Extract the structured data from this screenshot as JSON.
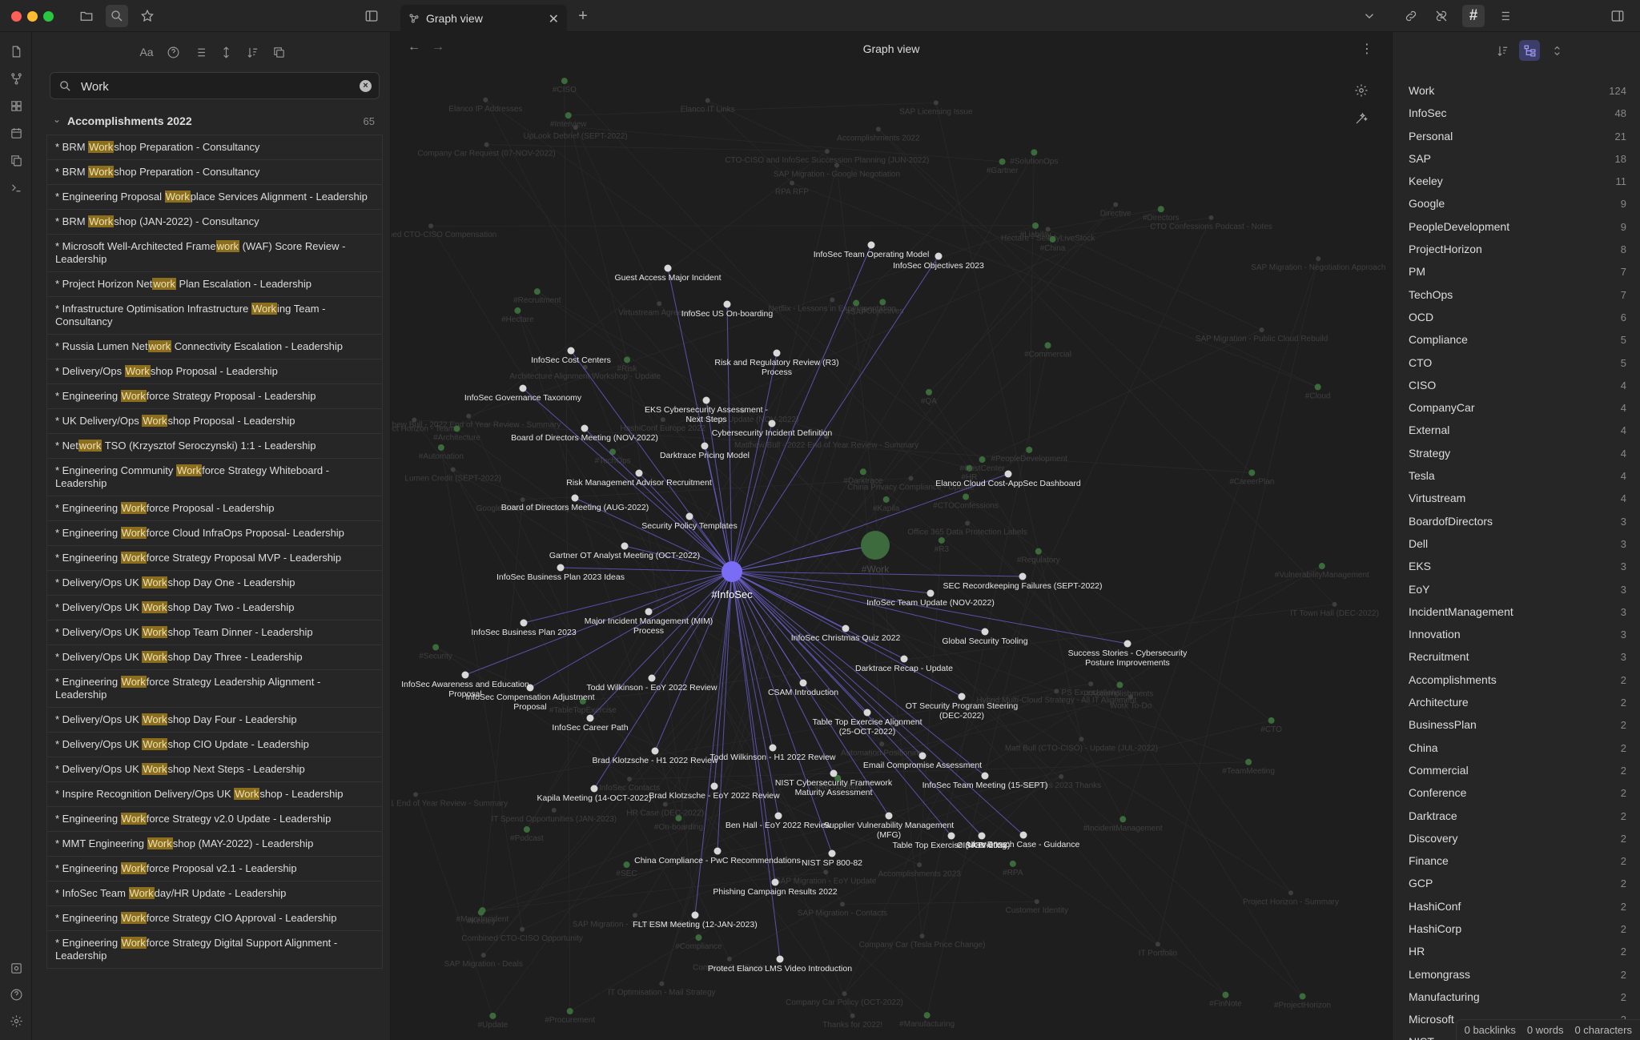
{
  "window": {
    "tab_title": "Graph view"
  },
  "search": {
    "query": "Work",
    "group_title": "Accomplishments 2022",
    "group_count": "65",
    "results": [
      [
        "* BRM ",
        "Work",
        "shop Preparation - Consultancy"
      ],
      [
        "* BRM ",
        "Work",
        "shop Preparation - Consultancy"
      ],
      [
        "* Engineering Proposal ",
        "Work",
        "place Services Alignment - Leadership"
      ],
      [
        "* BRM ",
        "Work",
        "shop (JAN-2022) - Consultancy"
      ],
      [
        "* Microsoft Well-Architected Frame",
        "work",
        " (WAF) Score Review - Leadership"
      ],
      [
        "* Project Horizon Net",
        "work",
        " Plan Escalation - Leadership"
      ],
      [
        "* Infrastructure Optimisation Infrastructure ",
        "Work",
        "ing Team - Consultancy"
      ],
      [
        "* Russia Lumen Net",
        "work",
        " Connectivity Escalation - Leadership"
      ],
      [
        "* Delivery/Ops ",
        "Work",
        "shop Proposal - Leadership"
      ],
      [
        "* Engineering ",
        "Work",
        "force Strategy Proposal - Leadership"
      ],
      [
        "* UK Delivery/Ops ",
        "Work",
        "shop Proposal - Leadership"
      ],
      [
        "* Net",
        "work",
        " TSO (Krzysztof Seroczynski) 1:1 - Leadership"
      ],
      [
        "* Engineering Community ",
        "Work",
        "force Strategy Whiteboard - Leadership"
      ],
      [
        "* Engineering ",
        "Work",
        "force Proposal - Leadership"
      ],
      [
        "* Engineering ",
        "Work",
        "force Cloud InfraOps Proposal- Leadership"
      ],
      [
        "* Engineering ",
        "Work",
        "force Strategy Proposal MVP - Leadership"
      ],
      [
        "* Delivery/Ops UK ",
        "Work",
        "shop Day One - Leadership"
      ],
      [
        "* Delivery/Ops UK ",
        "Work",
        "shop Day Two - Leadership"
      ],
      [
        "* Delivery/Ops UK ",
        "Work",
        "shop Team Dinner - Leadership"
      ],
      [
        "* Delivery/Ops UK ",
        "Work",
        "shop Day Three - Leadership"
      ],
      [
        "* Engineering ",
        "Work",
        "force Strategy Leadership Alignment - Leadership"
      ],
      [
        "* Delivery/Ops UK ",
        "Work",
        "shop Day Four - Leadership"
      ],
      [
        "* Delivery/Ops UK ",
        "Work",
        "shop CIO Update - Leadership"
      ],
      [
        "* Delivery/Ops UK ",
        "Work",
        "shop Next Steps - Leadership"
      ],
      [
        "* Inspire Recognition Delivery/Ops UK ",
        "Work",
        "shop - Leadership"
      ],
      [
        "* Engineering ",
        "Work",
        "force Strategy v2.0 Update - Leadership"
      ],
      [
        "* MMT Engineering ",
        "Work",
        "shop (MAY-2022) - Leadership"
      ],
      [
        "* Engineering ",
        "Work",
        "force Proposal v2.1 - Leadership"
      ],
      [
        "* InfoSec Team ",
        "Work",
        "day/HR Update - Leadership"
      ],
      [
        "* Engineering ",
        "Work",
        "force Strategy CIO Approval - Leadership"
      ],
      [
        "* Engineering ",
        "Work",
        "force Strategy Digital Support Alignment - Leadership"
      ]
    ]
  },
  "graph": {
    "title": "Graph view",
    "hub_label": "#InfoSec",
    "work_label": "#Work",
    "colors": {
      "hub": "#7b6cf6",
      "work": "#3d6b3d",
      "node": "#d8d8d8",
      "edge": "#6f63d6",
      "bg_node": "#3b6b3b"
    },
    "nodes": [
      {
        "label": "Guest Access Major Incident"
      },
      {
        "label": "InfoSec Team Operating Model"
      },
      {
        "label": "InfoSec Objectives 2023"
      },
      {
        "label": "InfoSec US On-boarding"
      },
      {
        "label": "InfoSec Cost Centers"
      },
      {
        "label": "Risk and Regulatory Review (R3) Process"
      },
      {
        "label": "EKS Cybersecurity Assessment - Next Steps"
      },
      {
        "label": "InfoSec Governance Taxonomy"
      },
      {
        "label": "Board of Directors Meeting (NOV-2022)"
      },
      {
        "label": "Cybersecurity Incident Definition"
      },
      {
        "label": "Darktrace Pricing Model"
      },
      {
        "label": "Risk Management Advisor Recruitment"
      },
      {
        "label": "Board of Directors Meeting (AUG-2022)"
      },
      {
        "label": "Security Policy Templates"
      },
      {
        "label": "Elanco Cloud Cost-AppSec Dashboard"
      },
      {
        "label": "Gartner OT Analyst Meeting (OCT-2022)"
      },
      {
        "label": "InfoSec Business Plan 2023 Ideas"
      },
      {
        "label": "SEC Recordkeeping Failures (SEPT-2022)"
      },
      {
        "label": "InfoSec Team Update (NOV-2022)"
      },
      {
        "label": "Major Incident Management (MIM) Process"
      },
      {
        "label": "InfoSec Business Plan 2023"
      },
      {
        "label": "InfoSec Christmas Quiz 2022"
      },
      {
        "label": "Global Security Tooling"
      },
      {
        "label": "Success Stories - Cybersecurity Posture Improvements"
      },
      {
        "label": "Darktrace Recap - Update"
      },
      {
        "label": "InfoSec Awareness and Education Proposal"
      },
      {
        "label": "Todd Wilkinson - EoY 2022 Review"
      },
      {
        "label": "InfoSec Compensation Adjustment Proposal"
      },
      {
        "label": "CSAM Introduction"
      },
      {
        "label": "OT Security Program Steering (DEC-2022)"
      },
      {
        "label": "InfoSec Career Path"
      },
      {
        "label": "Table Top Exercise Alignment (25-OCT-2022)"
      },
      {
        "label": "Brad Klotzsche - H1 2022 Review"
      },
      {
        "label": "Todd Wilkinson - H1 2022 Review"
      },
      {
        "label": "Email Compromise Assessment"
      },
      {
        "label": "Kapila Meeting (14-OCT-2022)"
      },
      {
        "label": "Brad Klotzsche - EoY 2022 Review"
      },
      {
        "label": "NIST Cybersecurity Framework Maturity Assessment"
      },
      {
        "label": "InfoSec Team Meeting (15-SEPT)"
      },
      {
        "label": "Ben Hall - EoY 2022 Review"
      },
      {
        "label": "Supplier Vulnerability Management (MFG)"
      },
      {
        "label": "Table Top Exercise (NOV-2022)"
      },
      {
        "label": "CISA Briefing"
      },
      {
        "label": "Uber Breach Case - Guidance"
      },
      {
        "label": "China Compliance - PwC Recommendations"
      },
      {
        "label": "NIST SP 800-82"
      },
      {
        "label": "Phishing Campaign Results 2022"
      },
      {
        "label": "FLT ESM Meeting (12-JAN-2023)"
      },
      {
        "label": "Protect Elanco LMS Video Introduction"
      }
    ],
    "bg_labels": [
      "#Hectare",
      "#MajorIncident",
      "#HR",
      "#On-boarding",
      "#SolutionOps",
      "#Objectives",
      "Hectare - SellMyLiveStock",
      "#R3",
      "UpLook Debrief (SEPT-2022)",
      "#ProjectHorizon",
      "Google EBC (SEPT-2022)",
      "SAP Migration - Negotiation Approach",
      "#Commercial",
      "#Procurement",
      "Netflix - Lessons in Experimentation",
      "#QA",
      "IT Spend Opportunities (JAN-2023)",
      "IT Strategy Update (NOV-2022)",
      "SAP Migration - Deals",
      "SAP Migration - Timeline and Team",
      "#SAP",
      "#CostCenter",
      "Work To-Do",
      "#Recruitment",
      "SAP Migration - Google Negotiation",
      "Lumen Credit (SEPT-2022)",
      "Hybrid Multi-Cloud Strategy - All IT Alignment",
      "#Cloud",
      "SAP Migration - EoY Update",
      "Virtustream Agreement",
      "Directive",
      "HR Case (DEC-2022)",
      "#FinNote",
      "Project Horizon - Summary",
      "#Accomplishments",
      "SAP Licensing Issue",
      "#TechOps",
      "TechOps 2023 Thanks",
      "IT Optimisation - Mail Strategy",
      "Project Horizon - Team",
      "#CTOConfessions",
      "#Update",
      "SAP Migration - Contacts",
      "Office 365 Data Protection Labels",
      "#Podcast",
      "SAP Migration - Public Cloud Rebuild",
      "Combined CTO-CISO Compensation",
      "Matt Bull (CTO-CISO) - Update (JUL-2022)",
      "Customer Identity",
      "#SEC",
      "#Interview",
      "Elanco IP Addresses",
      "Accomplishments 2023",
      "CTO Confessions Podcast - Notes",
      "Accomplishments 2022",
      "Matthew Bull - 2022 End of Year Review - Summary",
      "#Risk",
      "#Directors",
      "#CISO",
      "#Gartner",
      "RPA RFP",
      "#Darktrace",
      "Matthew Bull - 2021 End of Year Review - Summary",
      "#Recognition",
      "Company Car Quote",
      "PS Expectations",
      "HashiConf Europe 2022",
      "#Keeley",
      "Company Car Request (07-NOV-2022)",
      "Architecture Alignment Workshop - Update",
      "#Security",
      "Matthew Bull - 2022 End of Year Review - Summary",
      "Company Car (Tesla Price Change)",
      "China Privacy Compliance - Update",
      "Combined CTO-CISO Opportunity",
      "#Regulatory",
      "#CTO",
      "Company Car Policy (OCT-2022)",
      "#CareerPlan",
      "Automation Positioning",
      "IT Portfolio",
      "#Manufacturing",
      "#RPA",
      "CTO-CISO and InfoSec Succession Planning (JUN-2022)",
      "IT Town Hall (DEC-2022)",
      "#PeopleDevelopment",
      "#IncidentManagement",
      "#Kapila",
      "#TeamMeeting",
      "#Architecture",
      "Thanks for 2022!",
      "#Liability",
      "#China",
      "Elanco IT Links",
      "#VulnerabilityManagement",
      "#Automation",
      "#TableTopExercise",
      "InfoSec Contacts",
      "#Compliance"
    ]
  },
  "tags": [
    {
      "name": "Work",
      "count": "124"
    },
    {
      "name": "InfoSec",
      "count": "48"
    },
    {
      "name": "Personal",
      "count": "21"
    },
    {
      "name": "SAP",
      "count": "18"
    },
    {
      "name": "Keeley",
      "count": "11"
    },
    {
      "name": "Google",
      "count": "9"
    },
    {
      "name": "PeopleDevelopment",
      "count": "9"
    },
    {
      "name": "ProjectHorizon",
      "count": "8"
    },
    {
      "name": "PM",
      "count": "7"
    },
    {
      "name": "TechOps",
      "count": "7"
    },
    {
      "name": "OCD",
      "count": "6"
    },
    {
      "name": "Compliance",
      "count": "5"
    },
    {
      "name": "CTO",
      "count": "5"
    },
    {
      "name": "CISO",
      "count": "4"
    },
    {
      "name": "CompanyCar",
      "count": "4"
    },
    {
      "name": "External",
      "count": "4"
    },
    {
      "name": "Strategy",
      "count": "4"
    },
    {
      "name": "Tesla",
      "count": "4"
    },
    {
      "name": "Virtustream",
      "count": "4"
    },
    {
      "name": "BoardofDirectors",
      "count": "3"
    },
    {
      "name": "Dell",
      "count": "3"
    },
    {
      "name": "EKS",
      "count": "3"
    },
    {
      "name": "EoY",
      "count": "3"
    },
    {
      "name": "IncidentManagement",
      "count": "3"
    },
    {
      "name": "Innovation",
      "count": "3"
    },
    {
      "name": "Recruitment",
      "count": "3"
    },
    {
      "name": "Accomplishments",
      "count": "2"
    },
    {
      "name": "Architecture",
      "count": "2"
    },
    {
      "name": "BusinessPlan",
      "count": "2"
    },
    {
      "name": "China",
      "count": "2"
    },
    {
      "name": "Commercial",
      "count": "2"
    },
    {
      "name": "Conference",
      "count": "2"
    },
    {
      "name": "Darktrace",
      "count": "2"
    },
    {
      "name": "Discovery",
      "count": "2"
    },
    {
      "name": "Finance",
      "count": "2"
    },
    {
      "name": "GCP",
      "count": "2"
    },
    {
      "name": "HashiConf",
      "count": "2"
    },
    {
      "name": "HashiCorp",
      "count": "2"
    },
    {
      "name": "HR",
      "count": "2"
    },
    {
      "name": "Lemongrass",
      "count": "2"
    },
    {
      "name": "Manufacturing",
      "count": "2"
    },
    {
      "name": "Microsoft",
      "count": "2"
    },
    {
      "name": "NIST",
      "count": ""
    }
  ],
  "status": {
    "backlinks": "0 backlinks",
    "words": "0 words",
    "characters": "0 characters"
  }
}
